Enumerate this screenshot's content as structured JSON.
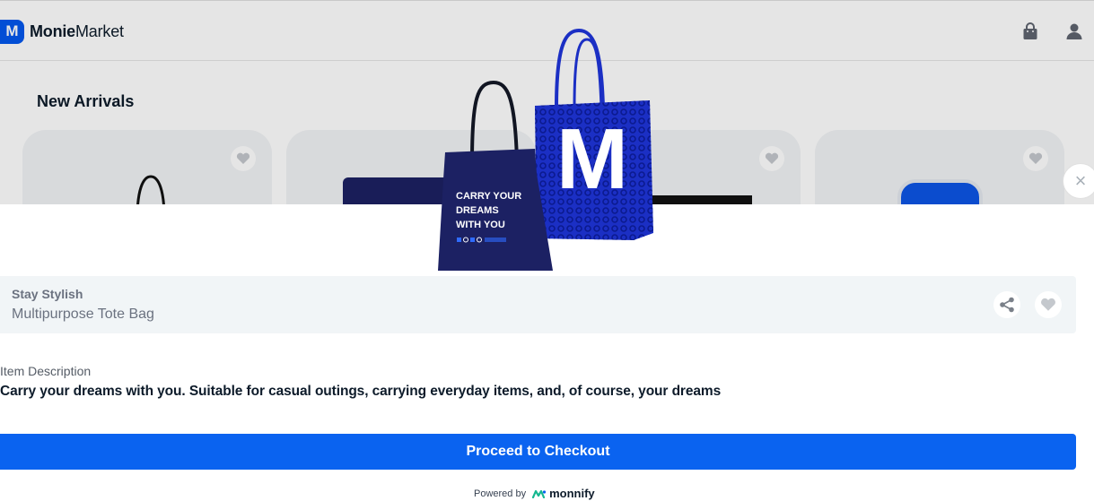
{
  "app": {
    "logo_letter": "M",
    "logo_bold": "Monie",
    "logo_regular": "Market"
  },
  "header": {
    "icons": [
      "shopping-bag-icon",
      "user-icon"
    ]
  },
  "main": {
    "section_title": "New Arrivals"
  },
  "product_image": {
    "bag_front_text_line1": "CARRY YOUR",
    "bag_front_text_line2": "DREAMS",
    "bag_front_text_line3": "WITH YOU",
    "bag_back_letter": "M"
  },
  "modal": {
    "close_symbol": "×",
    "category": "Stay Stylish",
    "product_name": "Multipurpose Tote Bag",
    "description_label": "Item Description",
    "description": "Carry your dreams with you. Suitable for casual outings, carrying everyday items, and, of course, your dreams",
    "checkout_label": "Proceed to Checkout",
    "powered_by": "Powered by",
    "provider": "monnify"
  },
  "colors": {
    "brand_blue": "#0357ee",
    "button_blue": "#0a63f0",
    "bag_navy": "#1c2163",
    "bag_blue": "#1b2fc4",
    "info_bg": "#f1f5f7"
  }
}
